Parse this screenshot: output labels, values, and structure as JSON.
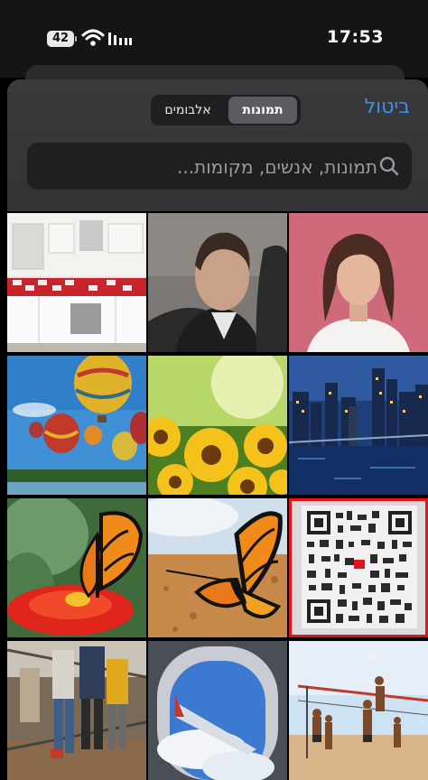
{
  "status_bar": {
    "battery": "42",
    "time": "17:53"
  },
  "header": {
    "cancel_label": "ביטול",
    "segments": [
      {
        "label": "תמונות",
        "active": true
      },
      {
        "label": "אלבומים",
        "active": false
      }
    ],
    "search_placeholder": "תמונות, אנשים, מקומות..."
  },
  "photos": [
    {
      "name": "kitchen"
    },
    {
      "name": "man-portrait"
    },
    {
      "name": "woman-portrait"
    },
    {
      "name": "hot-air-balloons"
    },
    {
      "name": "sunflowers"
    },
    {
      "name": "city-night"
    },
    {
      "name": "butterfly-on-flower"
    },
    {
      "name": "butterfly-on-ground"
    },
    {
      "name": "qr-code",
      "selected": true
    },
    {
      "name": "people-walking"
    },
    {
      "name": "airplane-window"
    },
    {
      "name": "beach-volleyball"
    }
  ],
  "colors": {
    "accent": "#3a8ff0",
    "selection": "#e0141c"
  }
}
